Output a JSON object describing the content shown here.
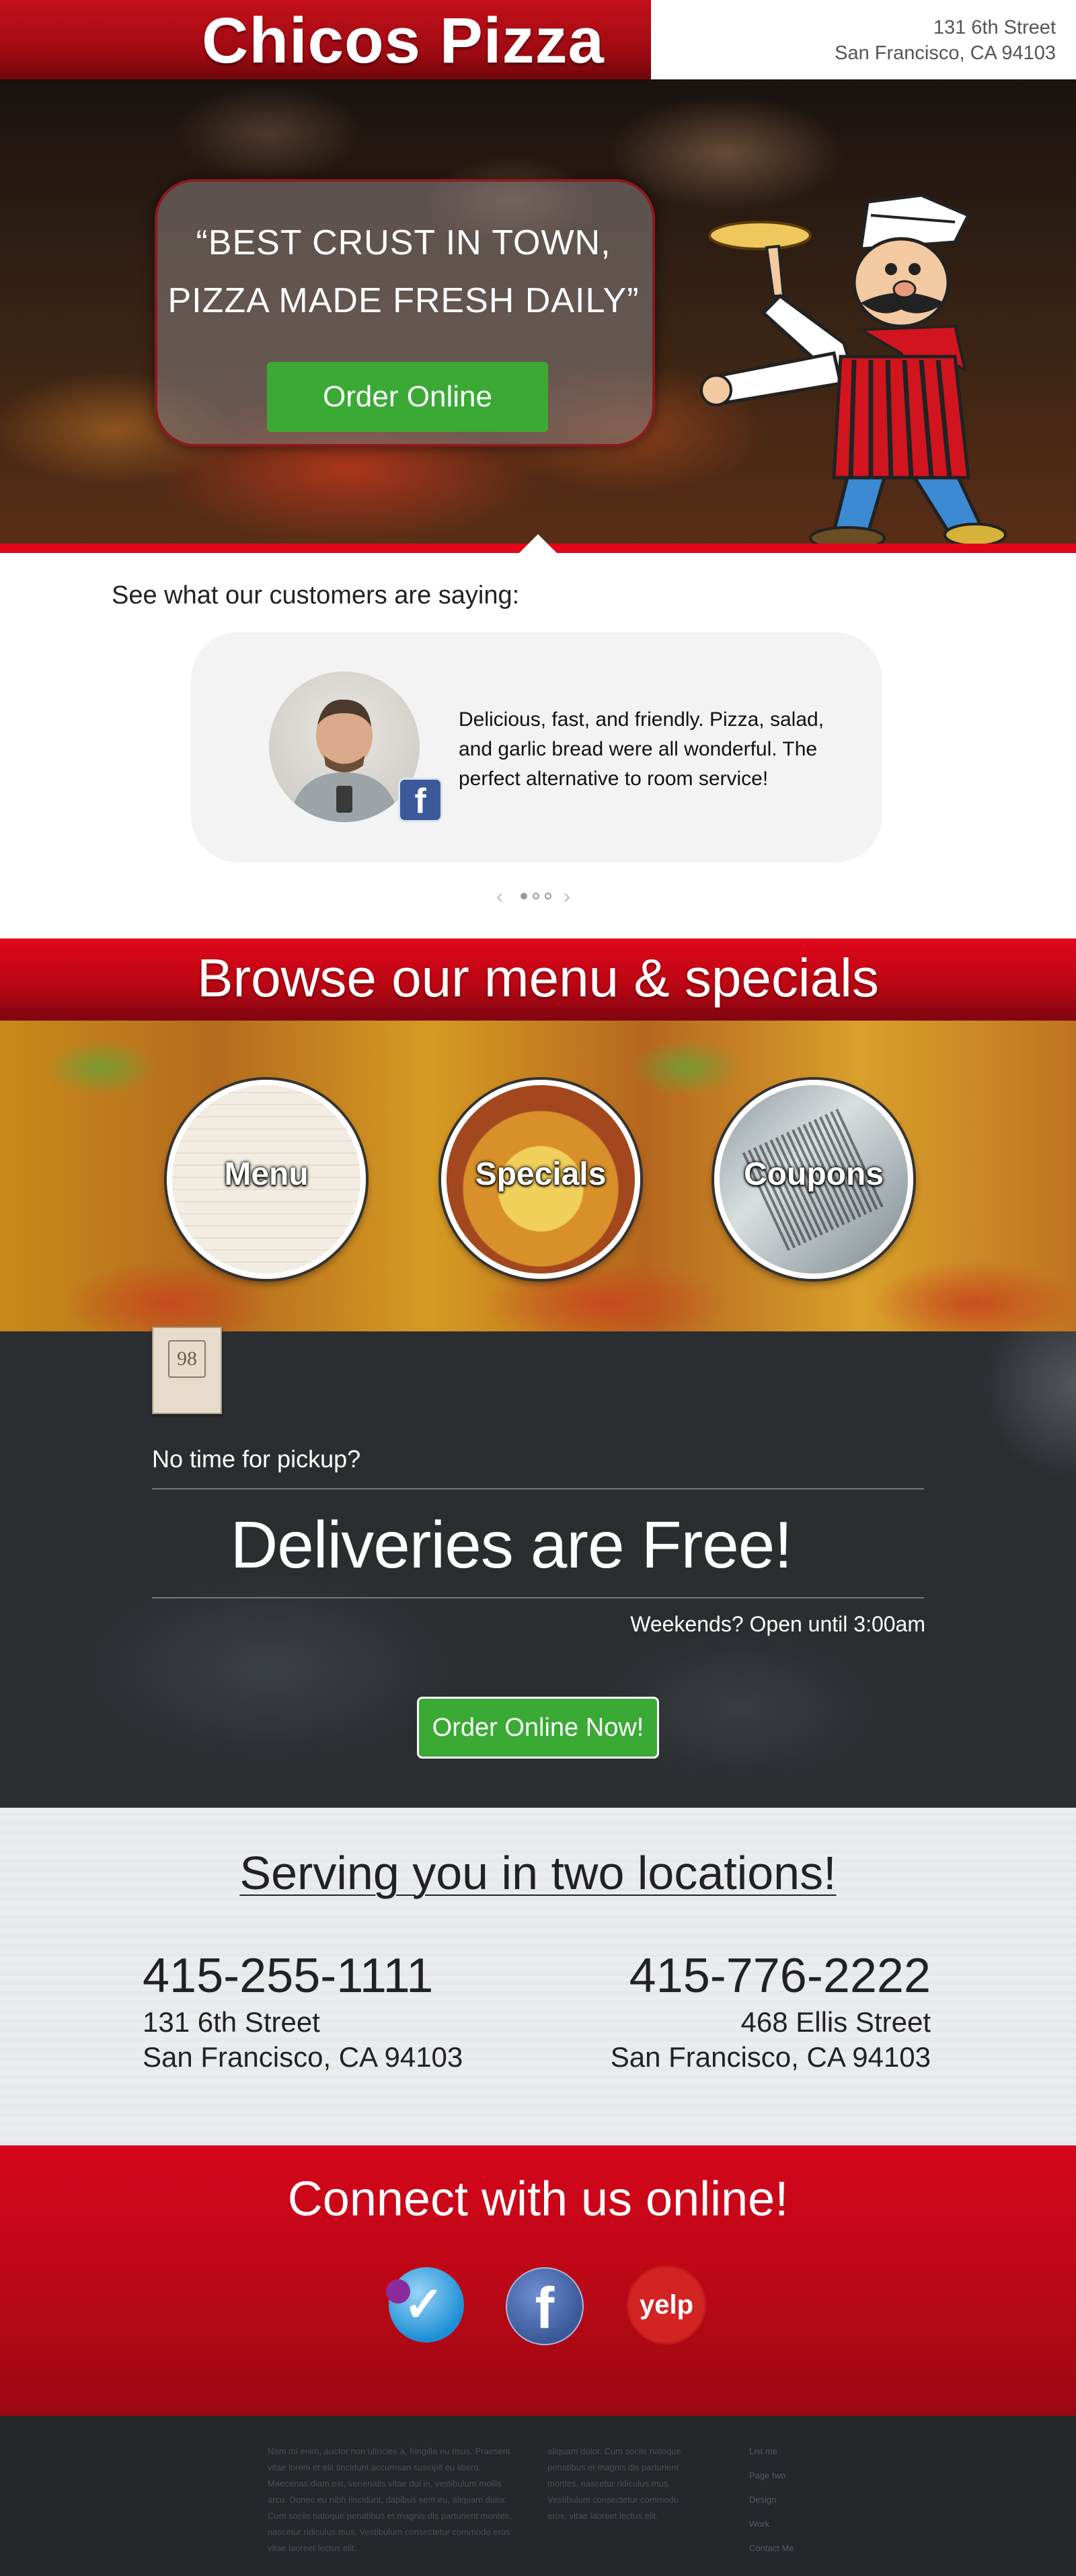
{
  "header": {
    "brand_name": "Chicos Pizza",
    "address_line1": "131 6th Street",
    "address_line2": "San Francisco, CA 94103"
  },
  "hero": {
    "quote_line1": "“BEST CRUST IN TOWN,",
    "quote_line2": "PIZZA MADE FRESH DAILY”",
    "order_button": "Order Online"
  },
  "testimonials": {
    "heading": "See what our customers are saying:",
    "quote": "Delicious, fast, and friendly. Pizza, salad, and garlic bread were all wonderful. The perfect alternative to room service!",
    "badge_letter": "f",
    "prev_arrow": "‹",
    "next_arrow": "›"
  },
  "browse": {
    "title": "Browse our menu & specials",
    "items": [
      {
        "label": "Menu"
      },
      {
        "label": "Specials"
      },
      {
        "label": "Coupons"
      }
    ]
  },
  "delivery": {
    "box_number": "98",
    "no_time": "No time for pickup?",
    "headline": "Deliveries are Free!",
    "weekends": "Weekends? Open until 3:00am",
    "order_button": "Order Online Now!"
  },
  "locations": {
    "title": "Serving you in two locations!",
    "items": [
      {
        "phone": "415-255-1111",
        "street": "131 6th Street",
        "city": "San Francisco, CA 94103"
      },
      {
        "phone": "415-776-2222",
        "street": "468 Ellis Street",
        "city": "San Francisco, CA 94103"
      }
    ]
  },
  "connect": {
    "title": "Connect with us online!",
    "facebook_letter": "f",
    "yelp_label": "yelp"
  },
  "footer": {
    "col1": "Nam mi enim, auctor non ultricies a, fringilla eu risus. Praesent vitae lorem et elit tincidunt accumsan suscipit eu libero. Maecenas diam est, venenatis vitae dui in, vestibulum mollis arcu. Donec eu nibh tincidunt, dapibus sem eu, aliquam dolor. Cum sociis natoque penatibus et magnis dis parturient montes, nascetur ridiculus mus. Vestibulum consectetur commodo eros vitae laoreet lectus elit.",
    "col2": "aliquam dolor. Cum sociis natoque penatibus et magnis dis parturient montes, nascetur ridiculus mus. Vestibulum consectetur commodo eros, vitae laoreet lectus elit.",
    "links": [
      "List me",
      "Page two",
      "Design",
      "Work",
      "Contact Me"
    ]
  },
  "colors": {
    "brand_red": "#c5101a",
    "accent_green": "#3aaa35",
    "dark_bg": "#2b2e31",
    "footer_bg": "#25282b"
  }
}
